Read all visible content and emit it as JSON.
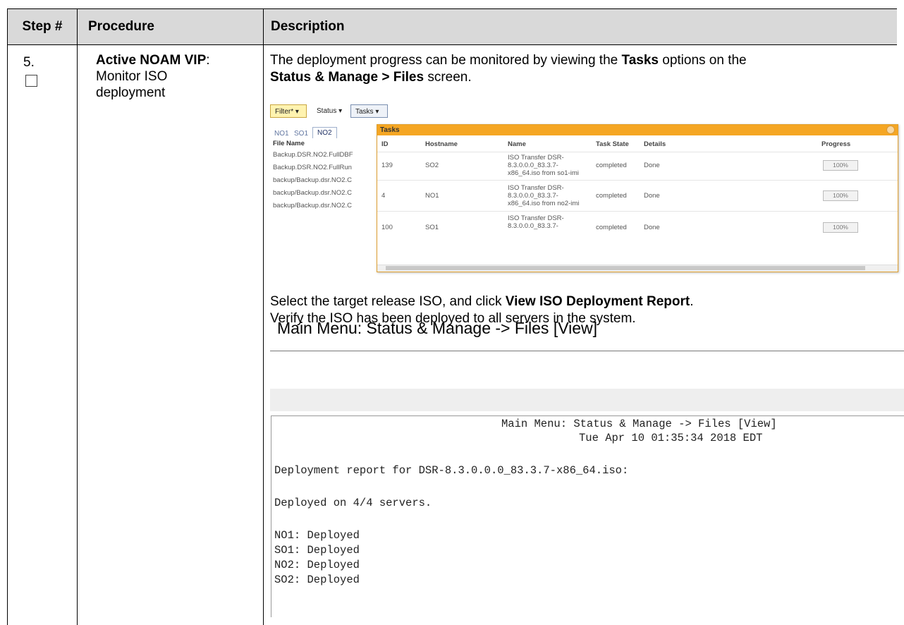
{
  "table": {
    "headers": [
      "Step #",
      "Procedure",
      "Description"
    ],
    "step_number": "5.",
    "procedure_bold": "Active NOAM VIP",
    "procedure_rest": ": Monitor ISO deployment",
    "intro": {
      "part1": "The deployment progress can be monitored by viewing the ",
      "bold1": "Tasks",
      "part2": " options on the ",
      "bold2": "Status & Manage > Files",
      "part3": " screen."
    },
    "select_text": {
      "part1": "Select the target release ISO, and click ",
      "bold1": "View ISO Deployment Report",
      "part2": "."
    },
    "verify_text": "Verify the ISO has been deployed to all servers in the system."
  },
  "gui": {
    "toolbar": {
      "filter": "Filter*",
      "status": "Status",
      "tasks": "Tasks"
    },
    "tabs": [
      "NO1",
      "SO1",
      "NO2"
    ],
    "file_list_header": "File Name",
    "file_rows": [
      "Backup.DSR.NO2.FullDBF",
      "Backup.DSR.NO2.FullRun",
      "backup/Backup.dsr.NO2.C",
      "backup/Backup.dsr.NO2.C",
      "backup/Backup.dsr.NO2.C"
    ],
    "tasks_popup": {
      "title": "Tasks",
      "columns": [
        "ID",
        "Hostname",
        "Name",
        "Task State",
        "Details",
        "Progress"
      ],
      "rows": [
        {
          "id": "139",
          "hostname": "SO2",
          "name1": "ISO Transfer DSR-",
          "name2": "8.3.0.0.0_83.3.7-",
          "name3": "x86_64.iso from so1-imi",
          "state": "completed",
          "details": "Done",
          "progress": "100%"
        },
        {
          "id": "4",
          "hostname": "NO1",
          "name1": "ISO Transfer DSR-",
          "name2": "8.3.0.0.0_83.3.7-",
          "name3": "x86_64.iso from no2-imi",
          "state": "completed",
          "details": "Done",
          "progress": "100%"
        },
        {
          "id": "100",
          "hostname": "SO1",
          "name1": "ISO Transfer DSR-",
          "name2": "8.3.0.0.0_83.3.7-",
          "name3": "",
          "state": "completed",
          "details": "Done",
          "progress": "100%"
        }
      ]
    }
  },
  "main_menu_title": "Main Menu: Status & Manage -> Files [View]",
  "report": {
    "header_line1": "Main Menu: Status & Manage -> Files [View]",
    "header_line2": "Tue Apr 10 01:35:34 2018 EDT",
    "deployment_line": "Deployment report for DSR-8.3.0.0.0_83.3.7-x86_64.iso:",
    "deployed_count": "Deployed on 4/4 servers.",
    "servers": [
      "NO1: Deployed",
      "SO1: Deployed",
      "NO2: Deployed",
      "SO2: Deployed"
    ]
  }
}
